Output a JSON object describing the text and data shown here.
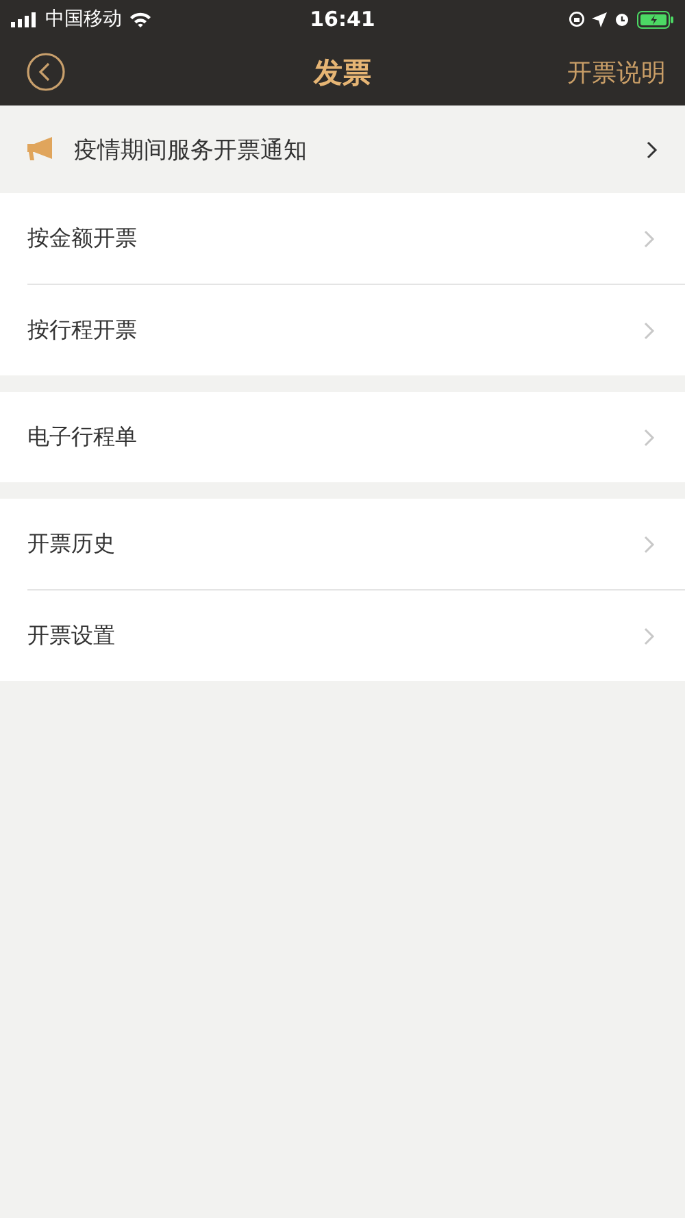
{
  "status_bar": {
    "carrier": "中国移动",
    "time": "16:41"
  },
  "nav": {
    "title": "发票",
    "action": "开票说明"
  },
  "notice": {
    "text": "疫情期间服务开票通知"
  },
  "groups": [
    {
      "items": [
        {
          "label": "按金额开票"
        },
        {
          "label": "按行程开票"
        }
      ]
    },
    {
      "items": [
        {
          "label": "电子行程单"
        }
      ]
    },
    {
      "items": [
        {
          "label": "开票历史"
        },
        {
          "label": "开票设置"
        }
      ]
    }
  ]
}
